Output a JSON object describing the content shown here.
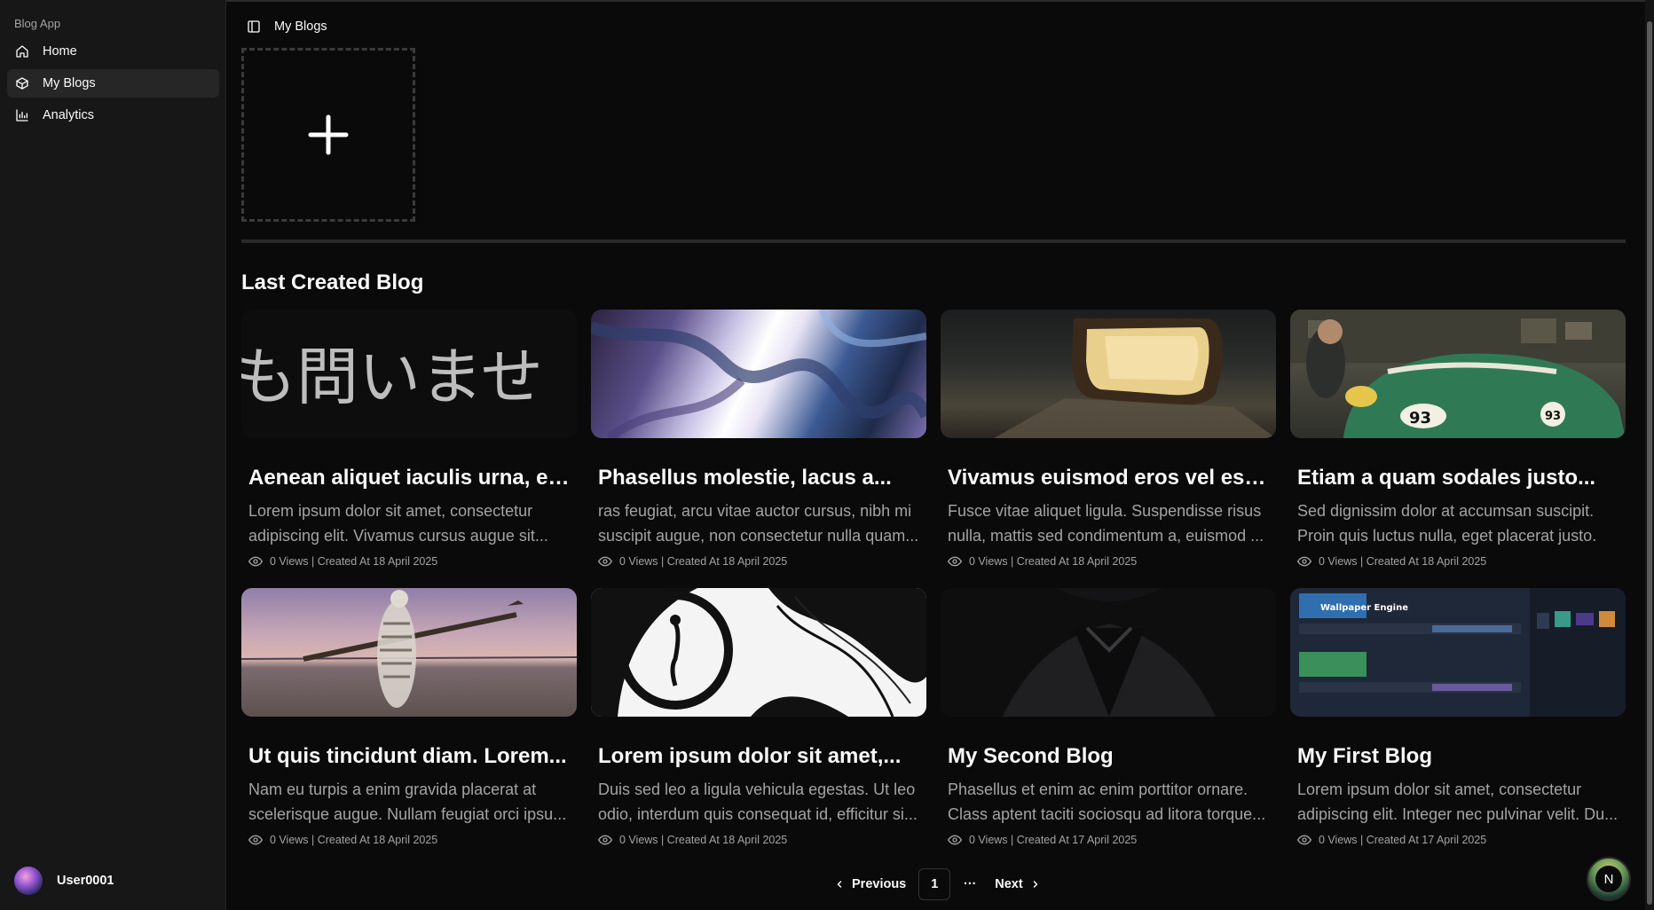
{
  "app": {
    "label": "Blog App"
  },
  "sidebar": {
    "items": [
      {
        "label": "Home",
        "icon": "home-icon",
        "active": false
      },
      {
        "label": "My Blogs",
        "icon": "box-icon",
        "active": true
      },
      {
        "label": "Analytics",
        "icon": "chart-icon",
        "active": false
      }
    ],
    "user": {
      "name": "User0001"
    }
  },
  "header": {
    "title": "My Blogs"
  },
  "section": {
    "title": "Last Created Blog"
  },
  "cards": [
    {
      "title": "Aenean aliquet iaculis urna, eg...",
      "description": "Lorem ipsum dolor sit amet, consectetur adipiscing elit. Vivamus cursus augue sit...",
      "meta": "0 Views | Created At 18 April 2025",
      "image": "japanese-text",
      "image_text": "も問いませ"
    },
    {
      "title": "Phasellus molestie, lacus a...",
      "description": "ras feugiat, arcu vitae auctor cursus, nibh mi suscipit augue, non consectetur nulla quam...",
      "meta": "0 Views | Created At 18 April 2025",
      "image": "abstract-blue"
    },
    {
      "title": "Vivamus euismod eros vel est...",
      "description": "Fusce vitae aliquet ligula. Suspendisse risus nulla, mattis sed condimentum a, euismod ...",
      "meta": "0 Views | Created At 18 April 2025",
      "image": "car-headlight"
    },
    {
      "title": "Etiam a quam sodales justo...",
      "description": "Sed dignissim dolor at accumsan suscipit. Proin quis luctus nulla, eget placerat justo.",
      "meta": "0 Views | Created At 18 April 2025",
      "image": "green-porsche",
      "image_text": "93"
    },
    {
      "title": "Ut quis tincidunt diam. Lorem...",
      "description": "Nam eu turpis a enim gravida placerat at scelerisque augue. Nullam feugiat orci ipsu...",
      "meta": "0 Views | Created At 18 April 2025",
      "image": "skeleton-beach"
    },
    {
      "title": "Lorem ipsum dolor sit amet,...",
      "description": "Duis sed leo a ligula vehicula egestas. Ut leo odio, interdum quis consequat id, efficitur si...",
      "meta": "0 Views | Created At 18 April 2025",
      "image": "ink-eye"
    },
    {
      "title": "My Second Blog",
      "description": "Phasellus et enim ac enim porttitor ornare. Class aptent taciti sociosqu ad litora torque...",
      "meta": "0 Views | Created At 17 April 2025",
      "image": "dark-suit"
    },
    {
      "title": "My First Blog",
      "description": "Lorem ipsum dolor sit amet, consectetur adipiscing elit. Integer nec pulvinar velit. Du...",
      "meta": "0 Views | Created At 17 April 2025",
      "image": "steam-profile",
      "image_text": "Wallpaper Engine"
    }
  ],
  "pagination": {
    "previous": "Previous",
    "current": "1",
    "ellipsis": "···",
    "next": "Next"
  },
  "fab": {
    "label": "N"
  },
  "colors": {
    "background": "#0a0a0a",
    "sidebar": "#171717",
    "active": "#262626",
    "muted": "#a3a3a3",
    "text": "#fafafa"
  }
}
